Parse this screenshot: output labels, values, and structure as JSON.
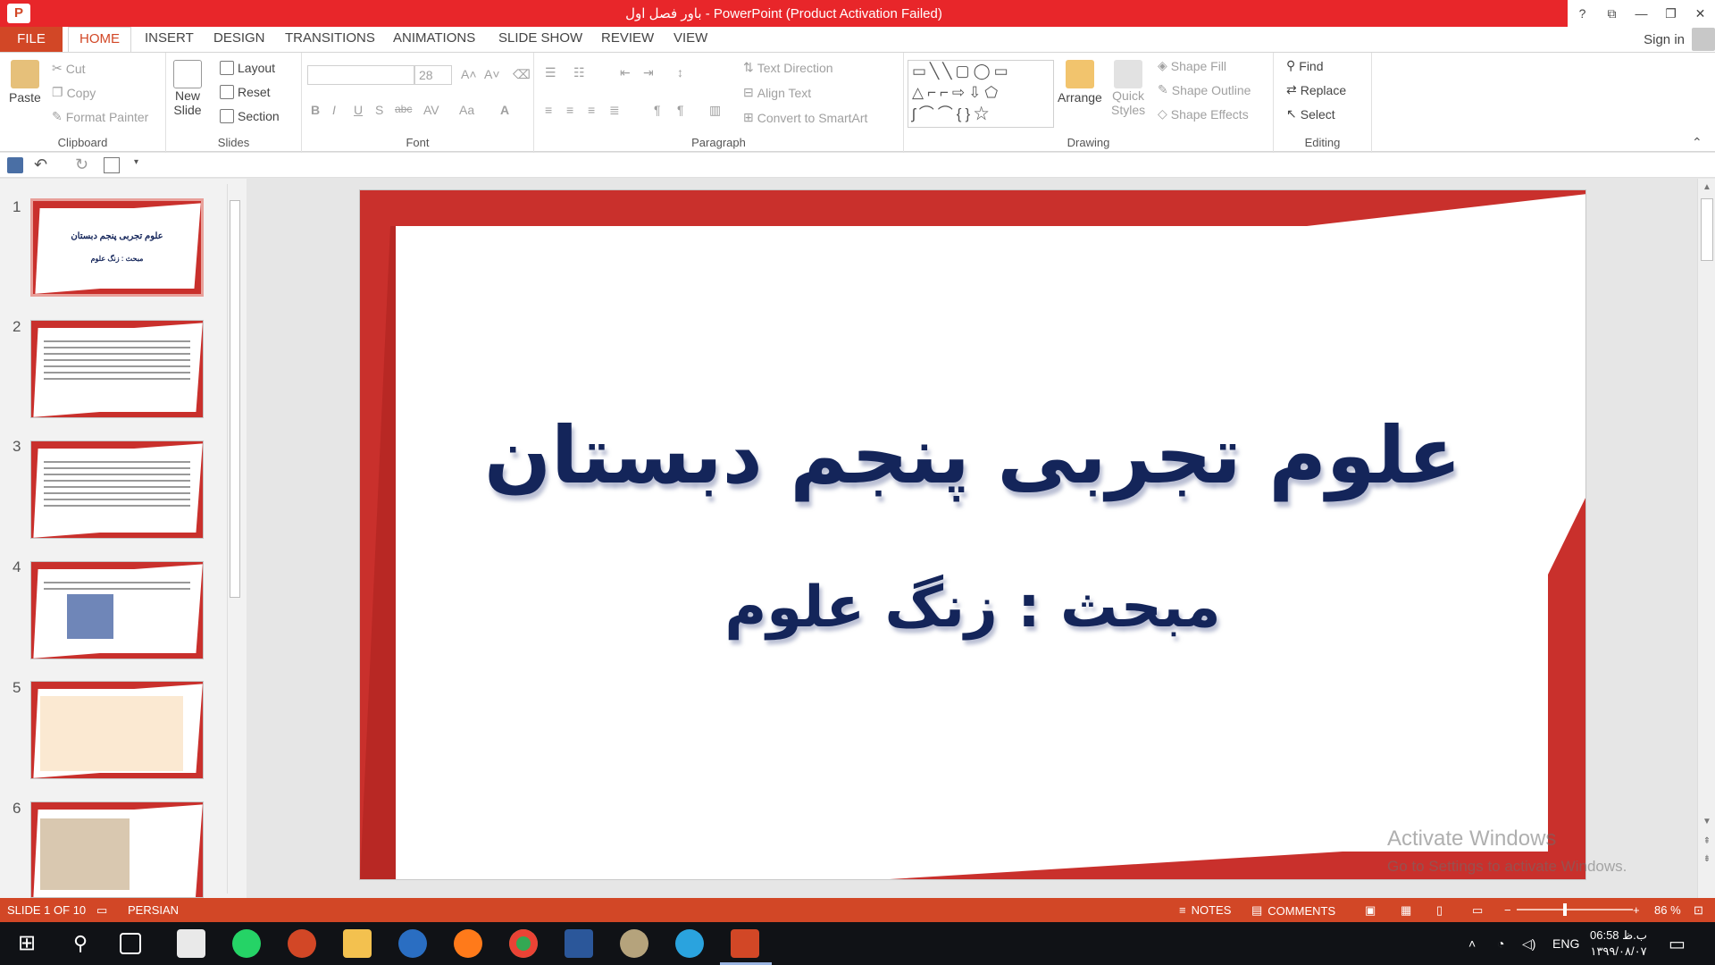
{
  "window": {
    "title": "باور فصل اول  -  PowerPoint (Product Activation Failed)",
    "app_icon": "P",
    "controls": [
      "?",
      "⧉",
      "—",
      "❐",
      "✕"
    ]
  },
  "tabs": {
    "file": "FILE",
    "items": [
      "HOME",
      "INSERT",
      "DESIGN",
      "TRANSITIONS",
      "ANIMATIONS",
      "SLIDE SHOW",
      "REVIEW",
      "VIEW"
    ],
    "active": "HOME",
    "sign_in": "Sign in"
  },
  "ribbon": {
    "clipboard": {
      "label": "Clipboard",
      "paste": "Paste",
      "cut": "Cut",
      "copy": "Copy",
      "format_painter": "Format Painter"
    },
    "slides": {
      "label": "Slides",
      "new_slide_1": "New",
      "new_slide_2": "Slide",
      "layout": "Layout",
      "reset": "Reset",
      "section": "Section"
    },
    "font": {
      "label": "Font",
      "font_size": "28",
      "bold": "B",
      "italic": "I",
      "underline": "U",
      "shadow": "S",
      "strike": "abc",
      "spacing": "AV",
      "case": "Aa",
      "color": "A"
    },
    "paragraph": {
      "label": "Paragraph",
      "text_direction": "Text Direction",
      "align_text": "Align Text",
      "convert_smartart": "Convert to SmartArt"
    },
    "drawing": {
      "label": "Drawing",
      "arrange": "Arrange",
      "quick_styles_1": "Quick",
      "quick_styles_2": "Styles",
      "shape_fill": "Shape Fill",
      "shape_outline": "Shape Outline",
      "shape_effects": "Shape Effects"
    },
    "editing": {
      "label": "Editing",
      "find": "Find",
      "replace": "Replace",
      "select": "Select"
    }
  },
  "thumbnails": [
    {
      "num": "1",
      "title": "علوم تجربی پنجم دبستان",
      "subtitle": "مبحث : زنگ علوم"
    },
    {
      "num": "2"
    },
    {
      "num": "3"
    },
    {
      "num": "4"
    },
    {
      "num": "5"
    },
    {
      "num": "6"
    }
  ],
  "slide": {
    "title": "علوم تجربی پنجم دبستان",
    "subtitle": "مبحث : زنگ علوم"
  },
  "watermark": {
    "line1": "Activate Windows",
    "line2": "Go to Settings to activate Windows."
  },
  "status": {
    "slide_of": "SLIDE 1 OF 10",
    "language": "PERSIAN",
    "notes": "NOTES",
    "comments": "COMMENTS",
    "zoom": "86 %",
    "zoom_level": 0.4
  },
  "taskbar": {
    "lang": "ENG",
    "time": "06:58 ب.ظ",
    "date": "۱۳۹۹/۰۸/۰۷"
  },
  "colors": {
    "accent": "#d24726",
    "title_bar": "#e8262a",
    "slide_frame": "#c9302c",
    "slide_text": "#14255a"
  }
}
